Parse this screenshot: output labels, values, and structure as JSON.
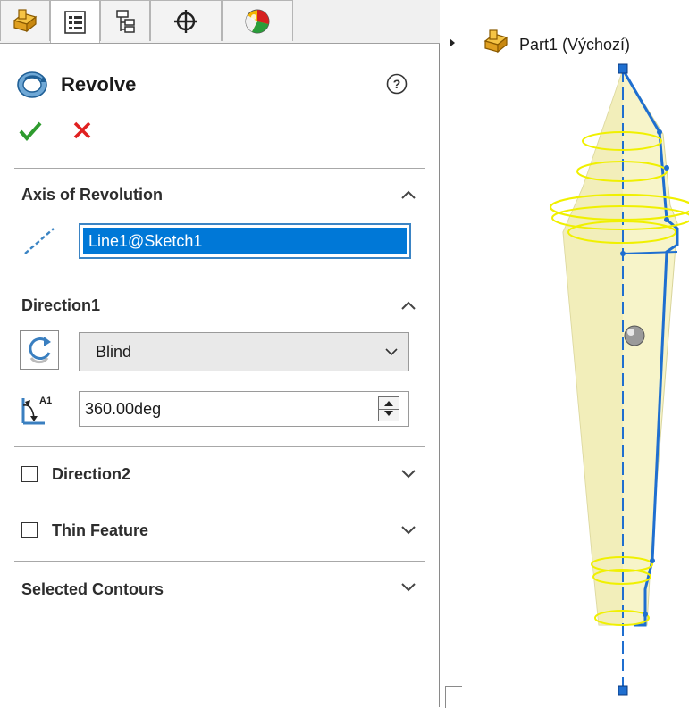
{
  "panel": {
    "tabs": [
      {
        "icon": "feature-manager-icon"
      },
      {
        "icon": "property-manager-icon"
      },
      {
        "icon": "configuration-manager-icon"
      },
      {
        "icon": "dimxpert-manager-icon"
      },
      {
        "icon": "display-manager-icon"
      }
    ],
    "title": "Revolve",
    "ok_icon": "checkmark-icon",
    "cancel_icon": "cross-icon",
    "sections": {
      "axis": {
        "title": "Axis of Revolution",
        "value": "Line1@Sketch1"
      },
      "direction1": {
        "title": "Direction1",
        "end_condition": "Blind",
        "angle": "360.00deg"
      },
      "direction2": {
        "title": "Direction2",
        "checked": false
      },
      "thin": {
        "title": "Thin Feature",
        "checked": false
      },
      "contours": {
        "title": "Selected Contours"
      }
    },
    "colors": {
      "accent": "#0078d7",
      "ok": "#2e9b2e",
      "cancel": "#e02020"
    }
  },
  "tree": {
    "part_label": "Part1  (Výchozí)"
  },
  "model": {
    "body_color": "#f7f4c9",
    "edge_color": "#1f6fd0",
    "highlight_color": "#f0f000"
  }
}
